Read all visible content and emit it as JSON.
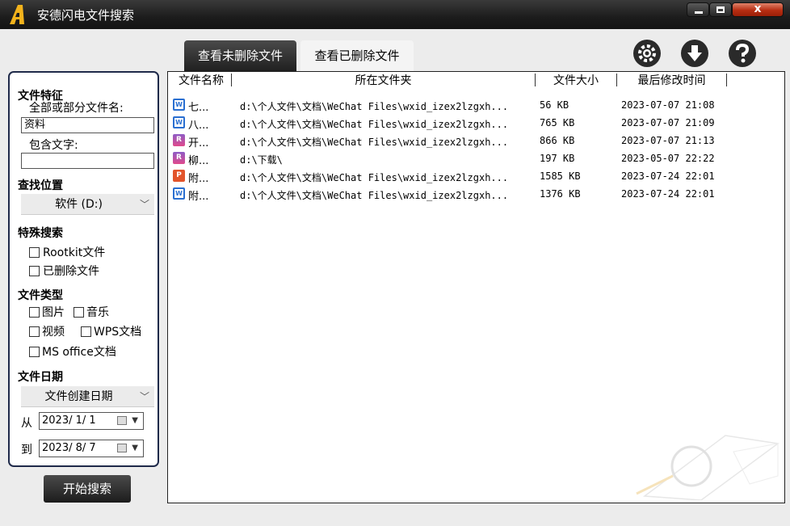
{
  "app": {
    "title": "安德闪电文件搜索"
  },
  "window_controls": {
    "minimize": "minimize",
    "maximize": "maximize",
    "close": "close",
    "close_glyph": "x"
  },
  "tabs": [
    {
      "label": "查看未删除文件",
      "active": true
    },
    {
      "label": "查看已删除文件",
      "active": false
    }
  ],
  "toolbar_icons": [
    "settings-gear-icon",
    "download-arrow-icon",
    "help-question-icon"
  ],
  "sidebar": {
    "file_features": {
      "title": "文件特征",
      "filename_label": "全部或部分文件名:",
      "filename_value": "资料",
      "contains_label": "包含文字:",
      "contains_value": ""
    },
    "location": {
      "title": "查找位置",
      "selected": "软件 (D:)"
    },
    "special": {
      "title": "特殊搜索",
      "rootkit": {
        "label": "Rootkit文件",
        "checked": false
      },
      "deleted": {
        "label": "已删除文件",
        "checked": false
      }
    },
    "file_type": {
      "title": "文件类型",
      "image": {
        "label": "图片",
        "checked": false
      },
      "music": {
        "label": "音乐",
        "checked": false
      },
      "video": {
        "label": "视频",
        "checked": false
      },
      "wps": {
        "label": "WPS文档",
        "checked": false
      },
      "msoffice": {
        "label": "MS office文档",
        "checked": false
      }
    },
    "file_date": {
      "title": "文件日期",
      "date_kind": "文件创建日期",
      "from_label": "从",
      "from_value": "2023/ 1/ 1",
      "to_label": "到",
      "to_value": "2023/ 8/ 7"
    },
    "start_button": "开始搜索"
  },
  "results": {
    "columns": [
      "文件名称",
      "所在文件夹",
      "文件大小",
      "最后修改时间"
    ],
    "rows": [
      {
        "icon": "word-doc-icon",
        "name": "七...",
        "folder": "d:\\个人文件\\文档\\WeChat Files\\wxid_izex2lzgxh...",
        "size": "56 KB",
        "modified": "2023-07-07 21:08"
      },
      {
        "icon": "word-doc-icon",
        "name": "八...",
        "folder": "d:\\个人文件\\文档\\WeChat Files\\wxid_izex2lzgxh...",
        "size": "765 KB",
        "modified": "2023-07-07 21:09"
      },
      {
        "icon": "rar-archive-icon",
        "name": "开...",
        "folder": "d:\\个人文件\\文档\\WeChat Files\\wxid_izex2lzgxh...",
        "size": "866 KB",
        "modified": "2023-07-07 21:13"
      },
      {
        "icon": "rar-archive-icon",
        "name": "柳...",
        "folder": "d:\\下载\\",
        "size": "197 KB",
        "modified": "2023-05-07 22:22"
      },
      {
        "icon": "pdf-doc-icon",
        "name": "附...",
        "folder": "d:\\个人文件\\文档\\WeChat Files\\wxid_izex2lzgxh...",
        "size": "1585 KB",
        "modified": "2023-07-24 22:01"
      },
      {
        "icon": "word-doc-icon",
        "name": "附...",
        "folder": "d:\\个人文件\\文档\\WeChat Files\\wxid_izex2lzgxh...",
        "size": "1376 KB",
        "modified": "2023-07-24 22:01"
      }
    ]
  },
  "colors": {
    "accent_dark": "#202020",
    "panel_border": "#1f2a4a",
    "close_red": "#b72d12",
    "icon_blue": "#2a6fd1"
  }
}
